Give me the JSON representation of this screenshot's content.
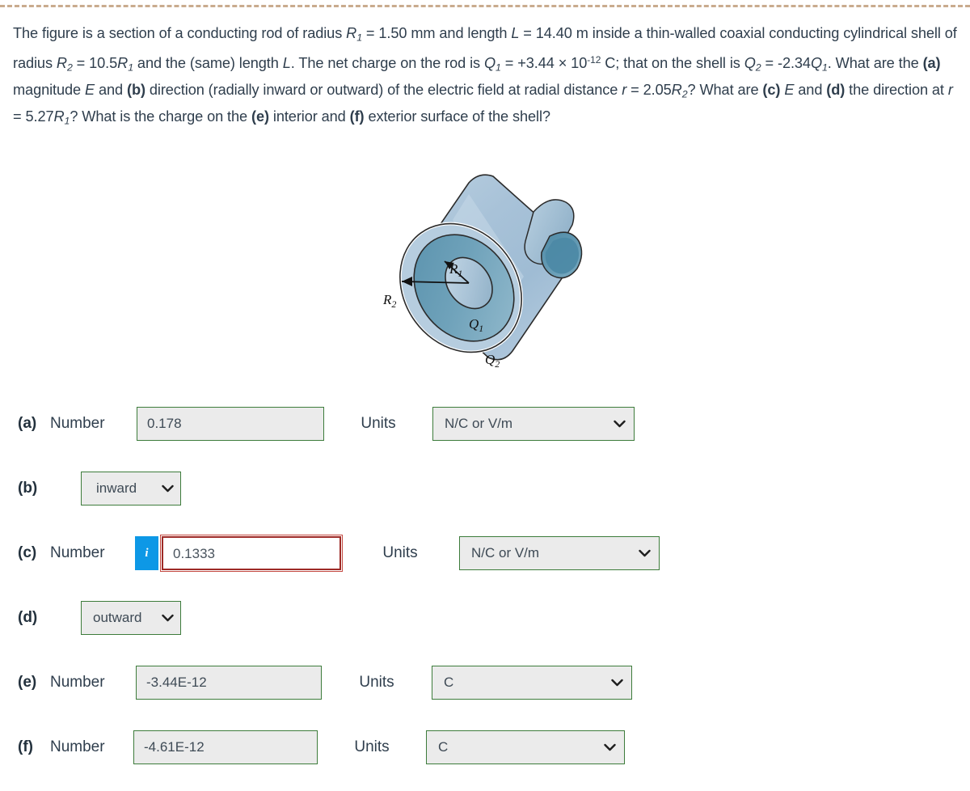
{
  "question": {
    "text_plain": "The figure is a section of a conducting rod of radius R1 = 1.50 mm and length L = 14.40 m inside a thin-walled coaxial conducting cylindrical shell of radius R2 = 10.5R1 and the (same) length L. The net charge on the rod is Q1 = +3.44 x 10^-12 C; that on the shell is Q2 = -2.34Q1. What are the (a) magnitude E and (b) direction (radially inward or outward) of the electric field at radial distance r = 2.05R2? What are (c) E and (d) the direction at r = 5.27R1? What is the charge on the (e) interior and (f) exterior surface of the shell?",
    "rod_radius_value": "1.50 mm",
    "rod_length_value": "14.40 m",
    "shell_radius_value": "10.5",
    "charge_rod_value": "+3.44 × 10",
    "charge_rod_exponent": "-12",
    "charge_shell_value": "-2.34",
    "r_first": "2.05",
    "r_second": "5.27"
  },
  "figure": {
    "label_r1": "R",
    "label_r1_sub": "1",
    "label_r2": "R",
    "label_r2_sub": "2",
    "label_q1": "Q",
    "label_q1_sub": "1",
    "label_q2": "Q",
    "label_q2_sub": "2",
    "alt": "Coaxial conducting rod inside a cylindrical shell"
  },
  "labels": {
    "number": "Number",
    "units": "Units"
  },
  "colors": {
    "valid_border": "#3d7c3b",
    "error_border": "#9d2a26",
    "info_blue": "#0d98e6",
    "field_bg": "#ebebeb",
    "text": "#2f3e4d",
    "rule": "#c9ab8e"
  },
  "rows": [
    {
      "tag": "(a)",
      "kind": "number",
      "value": "0.178",
      "units": "N/C or V/m",
      "state": "valid",
      "has_info": false
    },
    {
      "tag": "(b)",
      "kind": "direction",
      "value": "inward",
      "state": "valid",
      "has_info": false
    },
    {
      "tag": "(c)",
      "kind": "number",
      "value": "0.1333",
      "units": "N/C or V/m",
      "state": "error",
      "has_info": true,
      "info_glyph": "i"
    },
    {
      "tag": "(d)",
      "kind": "direction",
      "value": "outward",
      "state": "valid",
      "has_info": false
    },
    {
      "tag": "(e)",
      "kind": "number",
      "value": "-3.44E-12",
      "units": "C",
      "state": "valid",
      "has_info": false
    },
    {
      "tag": "(f)",
      "kind": "number",
      "value": "-4.61E-12",
      "units": "C",
      "state": "valid",
      "has_info": false
    }
  ]
}
